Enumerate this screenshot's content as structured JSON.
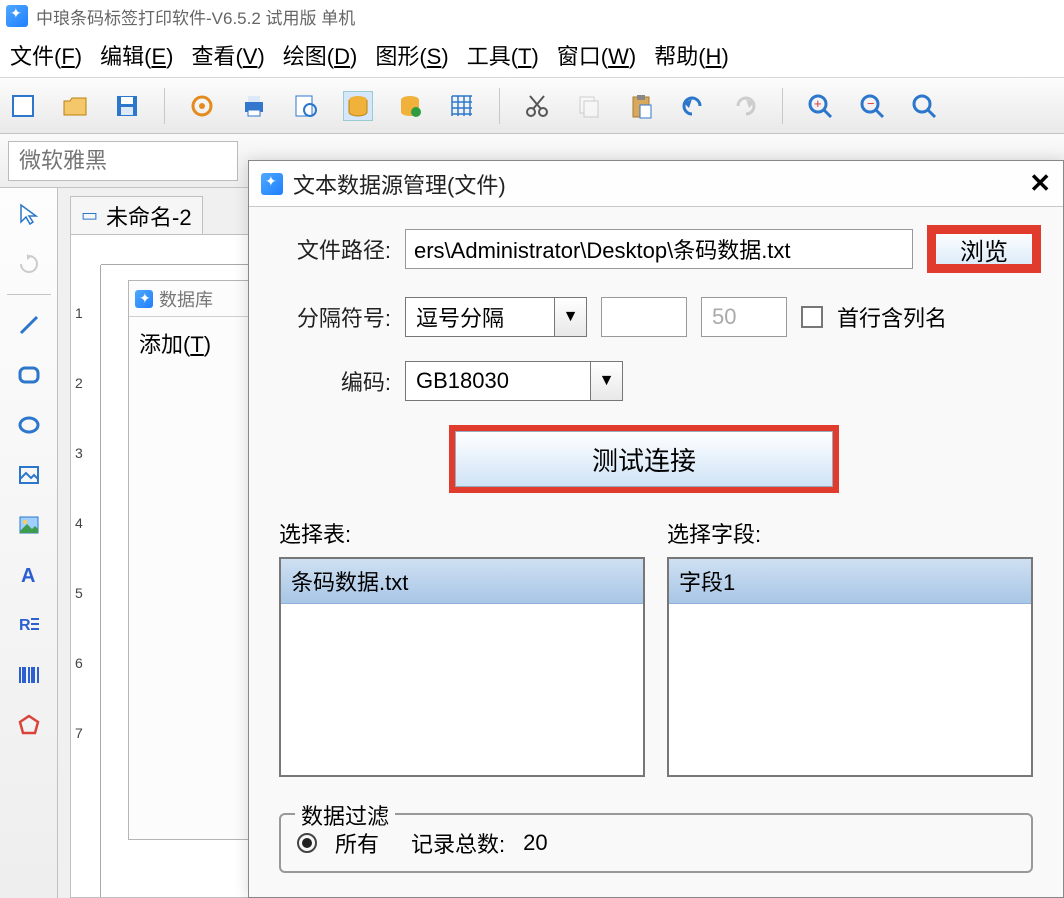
{
  "app": {
    "title": "中琅条码标签打印软件-V6.5.2 试用版 单机"
  },
  "menu": {
    "file": "文件(",
    "file_u": "F",
    "file_end": ")",
    "edit": "编辑(",
    "edit_u": "E",
    "edit_end": ")",
    "view": "查看(",
    "view_u": "V",
    "view_end": ")",
    "draw": "绘图(",
    "draw_u": "D",
    "draw_end": ")",
    "shape": "图形(",
    "shape_u": "S",
    "shape_end": ")",
    "tool": "工具(",
    "tool_u": "T",
    "tool_end": ")",
    "window": "窗口(",
    "window_u": "W",
    "window_end": ")",
    "help": "帮助(",
    "help_u": "H",
    "help_end": ")"
  },
  "fontbar": {
    "placeholder": "微软雅黑"
  },
  "doc": {
    "tab_label": "未命名-2"
  },
  "ruler": {
    "t1": "1",
    "t2": "2",
    "t3": "3",
    "t4": "4",
    "t5": "5",
    "t6": "6",
    "t7": "7"
  },
  "db_panel": {
    "title": "数据库",
    "add": "添加(",
    "add_u": "T",
    "add_end": ")"
  },
  "dialog": {
    "title": "文本数据源管理(文件)",
    "path_label": "文件路径:",
    "path_value": "ers\\Administrator\\Desktop\\条码数据.txt",
    "browse": "浏览",
    "delim_label": "分隔符号:",
    "delim_value": "逗号分隔",
    "num_blank": "",
    "num_ro": "50",
    "first_row_cols": "首行含列名",
    "encode_label": "编码:",
    "encode_value": "GB18030",
    "test_conn": "测试连接",
    "select_table": "选择表:",
    "select_field": "选择字段:",
    "table_item": "条码数据.txt",
    "field_item": "字段1",
    "filter_legend": "数据过滤",
    "radio_all": "所有",
    "record_count_label": "记录总数:",
    "record_count_value": "20"
  }
}
